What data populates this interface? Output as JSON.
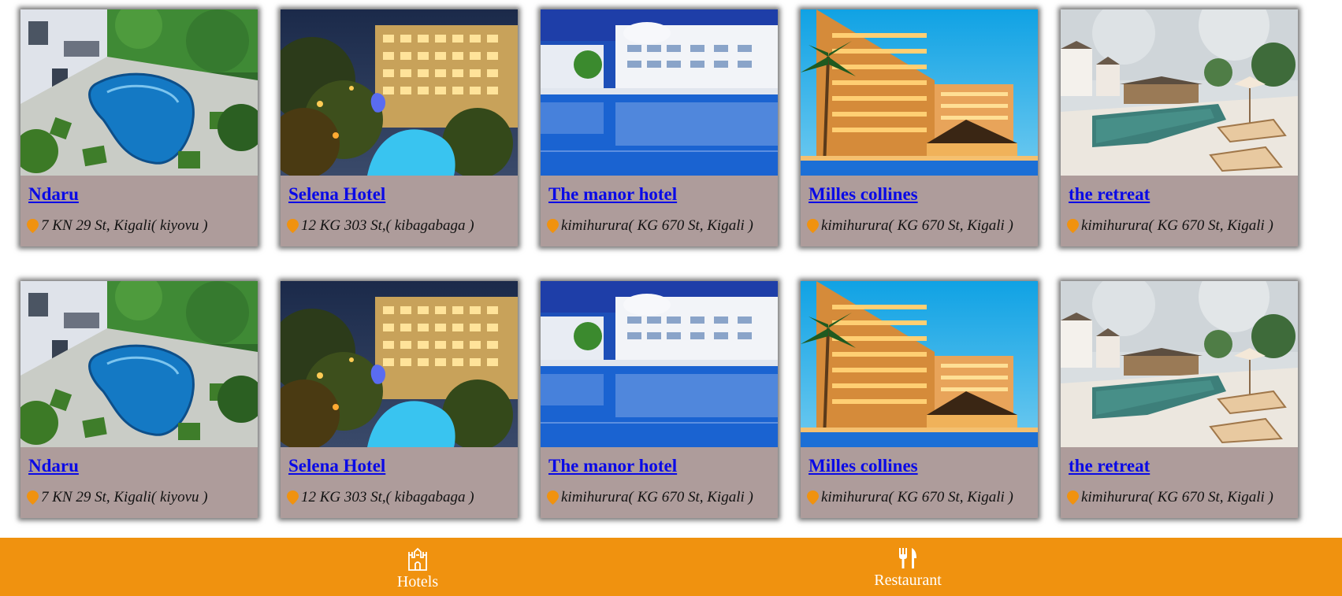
{
  "hotels": [
    {
      "name": "Ndaru",
      "address": "7 KN 29 St, Kigali( kiyovu )",
      "photo": "pool-villa"
    },
    {
      "name": "Selena Hotel",
      "address": "12 KG 303 St,( kibagabaga )",
      "photo": "night-hotel"
    },
    {
      "name": "The manor hotel",
      "address": "kimihurura( KG 670 St, Kigali )",
      "photo": "white-hotel-pool"
    },
    {
      "name": "Milles collines",
      "address": "kimihurura( KG 670 St, Kigali )",
      "photo": "sunset-hotel"
    },
    {
      "name": "the retreat",
      "address": "kimihurura( KG 670 St, Kigali )",
      "photo": "resort-pool"
    },
    {
      "name": "Ndaru",
      "address": "7 KN 29 St, Kigali( kiyovu )",
      "photo": "pool-villa"
    },
    {
      "name": "Selena Hotel",
      "address": "12 KG 303 St,( kibagabaga )",
      "photo": "night-hotel"
    },
    {
      "name": "The manor hotel",
      "address": "kimihurura( KG 670 St, Kigali )",
      "photo": "white-hotel-pool"
    },
    {
      "name": "Milles collines",
      "address": "kimihurura( KG 670 St, Kigali )",
      "photo": "sunset-hotel"
    },
    {
      "name": "the retreat",
      "address": "kimihurura( KG 670 St, Kigali )",
      "photo": "resort-pool"
    }
  ],
  "footer": {
    "hotels_label": "Hotels",
    "hotels_icon": "castle-icon",
    "restaurant_label": "Restaurant",
    "restaurant_icon": "fork-knife-icon"
  },
  "colors": {
    "card_bg": "#ae9c9b",
    "link": "#0a0ae6",
    "footer_bg": "#f0920f",
    "pin": "#f0920f"
  }
}
